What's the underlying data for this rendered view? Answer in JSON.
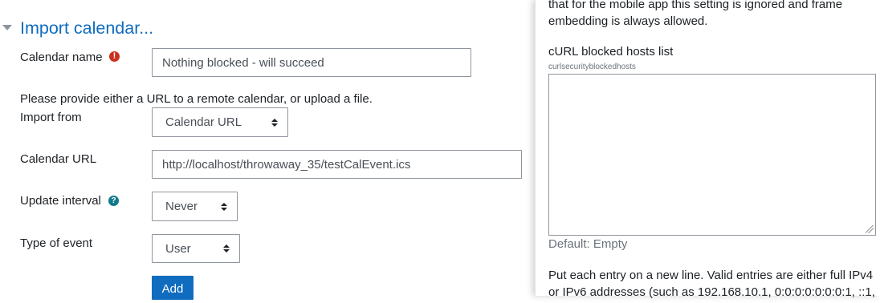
{
  "section": {
    "title": "Import calendar...",
    "toggle_icon": "chevron-down-icon"
  },
  "form": {
    "calendar_name_label": "Calendar name",
    "calendar_name_value": "Nothing blocked - will succeed",
    "required_icon": "!",
    "instructions": "Please provide either a URL to a remote calendar, or upload a file.",
    "import_from_label": "Import from",
    "import_from_value": "Calendar URL",
    "calendar_url_label": "Calendar URL",
    "calendar_url_value": "http://localhost/throwaway_35/testCalEvent.ics",
    "update_interval_label": "Update interval",
    "help_icon": "?",
    "update_interval_value": "Never",
    "type_of_event_label": "Type of event",
    "type_of_event_value": "User",
    "add_button": "Add"
  },
  "settings_panel": {
    "intro_line1": "that for the mobile app this setting is ignored and frame",
    "intro_line2": "embedding is always allowed.",
    "curl_blocked_title": "cURL blocked hosts list",
    "curl_blocked_key": "curlsecurityblockedhosts",
    "curl_blocked_value": "",
    "default_text": "Default: Empty",
    "desc_line1": "Put each entry on a new line. Valid entries are either full IPv4",
    "desc_line2": "or IPv6 addresses (such as 192.168.10.1, 0:0:0:0:0:0:0:1, ::1,"
  },
  "colors": {
    "accent": "#0f6cbf",
    "error": "#ca3120",
    "help": "#117a8b"
  }
}
